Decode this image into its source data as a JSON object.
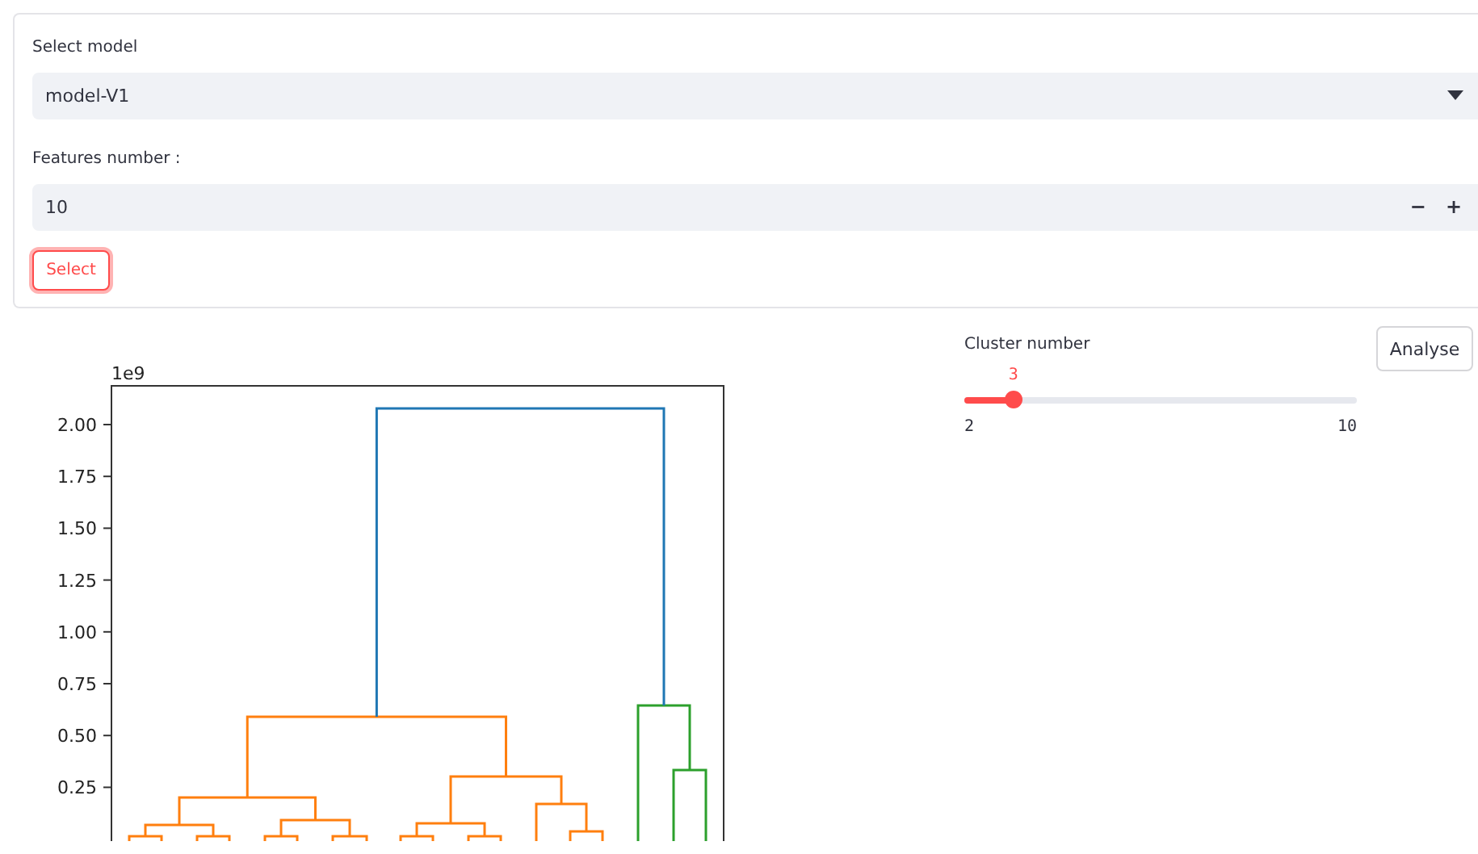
{
  "model_form": {
    "model_select": {
      "label": "Select model",
      "value": "model-V1"
    },
    "features_input": {
      "label": "Features number :",
      "value": "10",
      "decrement": "−",
      "increment": "+"
    },
    "select_button": "Select"
  },
  "cluster_slider": {
    "label": "Cluster number",
    "value": "3",
    "min": "2",
    "max": "10",
    "level": 0.125
  },
  "analyse_button": "Analyse",
  "plot": {
    "offset_label": "1e9",
    "yticks": [
      "2.00",
      "1.75",
      "1.50",
      "1.25",
      "1.00",
      "0.75",
      "0.50",
      "0.25"
    ]
  }
}
